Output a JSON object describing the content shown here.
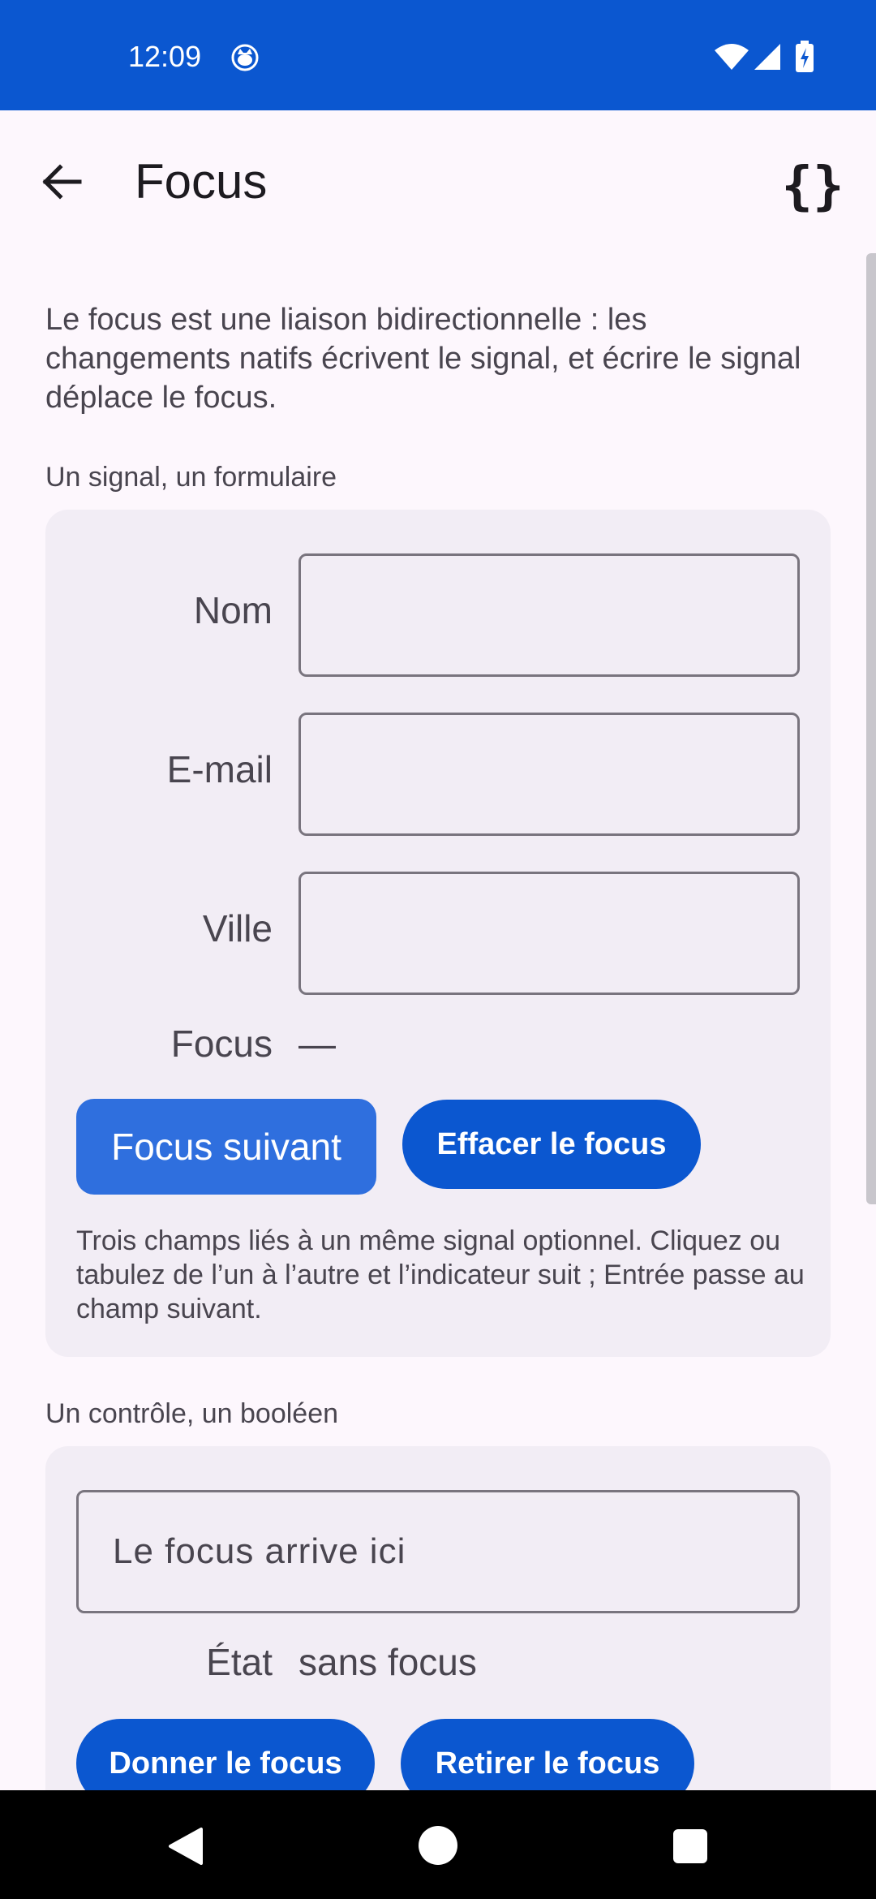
{
  "status_bar": {
    "time": "12:09",
    "app_icon": "cat-face-icon",
    "wifi_icon": "wifi-icon",
    "signal_icon": "cell-signal-icon",
    "battery_icon": "battery-charging-icon",
    "color": "#0b57d0"
  },
  "app_bar": {
    "title": "Focus",
    "back_icon": "arrow-back-icon",
    "code_label": "{}"
  },
  "intro": "Le focus est une liaison bidirectionnelle : les changements natifs écrivent le signal, et écrire le signal déplace le focus.",
  "section1": {
    "label": "Un signal, un formulaire",
    "fields": [
      {
        "label": "Nom",
        "value": ""
      },
      {
        "label": "E-mail",
        "value": ""
      },
      {
        "label": "Ville",
        "value": ""
      }
    ],
    "focus_label": "Focus",
    "focus_value": "—",
    "next_button": "Focus suivant",
    "clear_button": "Effacer le focus",
    "note": "Trois champs liés à un même signal optionnel. Cliquez ou tabulez de l’un à l’autre et l’indicateur suit ; Entrée passe au champ suivant."
  },
  "section2": {
    "label": "Un contrôle, un booléen",
    "input_placeholder": "Le focus arrive ici",
    "state_label": "État",
    "state_value": "sans focus",
    "give_button": "Donner le focus",
    "remove_button": "Retirer le focus"
  },
  "nav_bar": {
    "back_icon": "nav-back-icon",
    "home_icon": "nav-home-icon",
    "recents_icon": "nav-recents-icon"
  }
}
